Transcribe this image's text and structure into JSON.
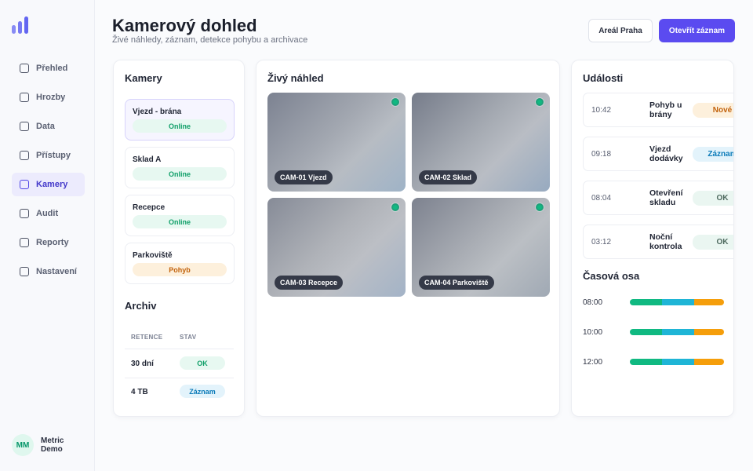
{
  "app": {
    "logo": "bar-chart-logo"
  },
  "sidebar": {
    "items": [
      {
        "label": "Přehled",
        "active": false
      },
      {
        "label": "Hrozby",
        "active": false
      },
      {
        "label": "Data",
        "active": false
      },
      {
        "label": "Přístupy",
        "active": false
      },
      {
        "label": "Kamery",
        "active": true
      },
      {
        "label": "Audit",
        "active": false
      },
      {
        "label": "Reporty",
        "active": false
      },
      {
        "label": "Nastavení",
        "active": false
      }
    ],
    "user": {
      "initials": "MM",
      "name": "Metric Demo"
    }
  },
  "header": {
    "title": "Kamerový dohled",
    "subtitle": "Živé náhledy, záznam, detekce pohybu a archivace",
    "area_button": "Areál Praha",
    "open_button": "Otevřít záznam"
  },
  "cameras": {
    "title": "Kamery",
    "items": [
      {
        "name": "Vjezd - brána",
        "status": "Online",
        "selected": true
      },
      {
        "name": "Sklad A",
        "status": "Online",
        "selected": false
      },
      {
        "name": "Recepce",
        "status": "Online",
        "selected": false
      },
      {
        "name": "Parkoviště",
        "status": "Pohyb",
        "selected": false
      }
    ]
  },
  "archive": {
    "title": "Archiv",
    "columns": [
      "RETENCE",
      "STAV"
    ],
    "rows": [
      {
        "retention": "30 dní",
        "status": "OK"
      },
      {
        "retention": "4 TB",
        "status": "Záznam"
      }
    ]
  },
  "live": {
    "title": "Živý náhled",
    "feeds": [
      {
        "label": "CAM-01 Vjezd",
        "live": true
      },
      {
        "label": "CAM-02 Sklad",
        "live": true
      },
      {
        "label": "CAM-03 Recepce",
        "live": true
      },
      {
        "label": "CAM-04 Parkoviště",
        "live": true
      }
    ]
  },
  "events": {
    "title": "Události",
    "items": [
      {
        "time": "10:42",
        "text": "Pohyb u brány",
        "badge": "Nové"
      },
      {
        "time": "09:18",
        "text": "Vjezd dodávky",
        "badge": "Záznam"
      },
      {
        "time": "08:04",
        "text": "Otevření skladu",
        "badge": "OK"
      },
      {
        "time": "03:12",
        "text": "Noční kontrola",
        "badge": "OK"
      }
    ]
  },
  "timeline": {
    "title": "Časová osa",
    "colors": [
      "#10b981",
      "#1fb5d6",
      "#f59e0b"
    ],
    "rows": [
      {
        "time": "08:00",
        "segments": [
          0.34,
          0.34,
          0.32
        ]
      },
      {
        "time": "10:00",
        "segments": [
          0.34,
          0.34,
          0.32
        ]
      },
      {
        "time": "12:00",
        "segments": [
          0.34,
          0.34,
          0.32
        ]
      }
    ]
  }
}
